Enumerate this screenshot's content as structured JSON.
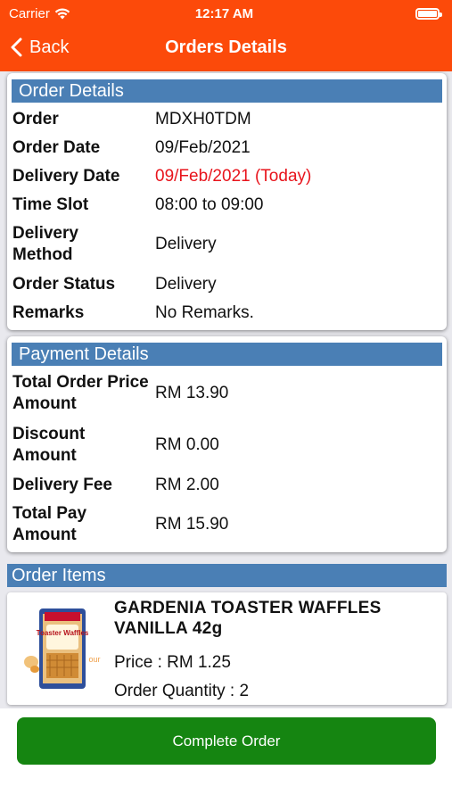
{
  "status_bar": {
    "carrier": "Carrier",
    "time": "12:17 AM"
  },
  "nav": {
    "back_label": "Back",
    "title": "Orders Details"
  },
  "order_details": {
    "header": "Order Details",
    "rows": [
      {
        "label": "Order",
        "value": "MDXH0TDM"
      },
      {
        "label": "Order Date",
        "value": "09/Feb/2021"
      },
      {
        "label": "Delivery Date",
        "value": "09/Feb/2021 (Today)"
      },
      {
        "label": "Time Slot",
        "value": "08:00 to 09:00"
      },
      {
        "label": "Delivery Method",
        "value": "Delivery"
      },
      {
        "label": "Order Status",
        "value": "Delivery"
      },
      {
        "label": "Remarks",
        "value": "No Remarks."
      }
    ]
  },
  "payment_details": {
    "header": "Payment Details",
    "rows": [
      {
        "label": "Total Order Price Amount",
        "value": "RM 13.90"
      },
      {
        "label": "Discount Amount",
        "value": "RM 0.00"
      },
      {
        "label": "Delivery Fee",
        "value": "RM 2.00"
      },
      {
        "label": "Total Pay Amount",
        "value": "RM 15.90"
      }
    ]
  },
  "order_items": {
    "header": "Order Items",
    "items": [
      {
        "name": "GARDENIA TOASTER WAFFLES VANILLA 42g",
        "price": "Price : RM 1.25",
        "quantity": "Order Quantity : 2",
        "image_text": "Toaster Waffles"
      }
    ]
  },
  "actions": {
    "complete_label": "Complete Order"
  },
  "colors": {
    "header": "#fc4a0a",
    "section": "#4a7fb5",
    "accent_red": "#e8141c",
    "button": "#158511"
  }
}
